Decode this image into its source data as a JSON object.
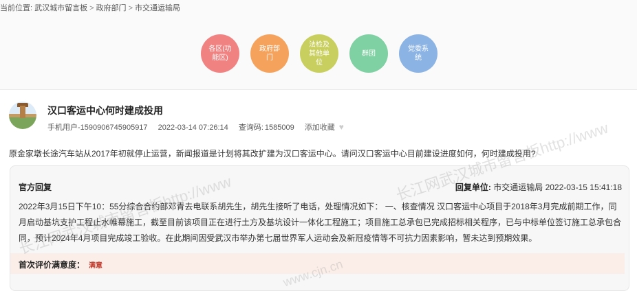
{
  "breadcrumb": {
    "label": "当前位置:",
    "items": [
      "武汉城市留言板",
      "政府部门",
      "市交通运输局"
    ],
    "separator": ">"
  },
  "categories": [
    {
      "label": "各区(功能区)",
      "color": "#f08282"
    },
    {
      "label": "政府部门",
      "color": "#f5a35c"
    },
    {
      "label": "法检及其他单位",
      "color": "#c8cf5e"
    },
    {
      "label": "群团",
      "color": "#7fd0a2"
    },
    {
      "label": "党委系统",
      "color": "#8bb3e3"
    }
  ],
  "post": {
    "title": "汉口客运中心何时建成投用",
    "user": "手机用户-1590906745905917",
    "datetime": "2022-03-14 07:26:14",
    "query_code_label": "查询码:",
    "query_code": "1585009",
    "favorite_label": "添加收藏",
    "question": "原金家墩长途汽车站从2017年初就停止运营，新闻报道是计划将其改扩建为汉口客运中心。请问汉口客运中心目前建设进度如何，何时建成投用?"
  },
  "reply": {
    "label": "官方回复",
    "unit_label": "回复单位:",
    "unit": "市交通运输局",
    "datetime": "2022-03-15 15:41:18",
    "body": "2022年3月15日下午10：55分综合合约部邓青去电联系胡先生，胡先生接听了电话，处理情况如下： 一、核查情况 汉口客运中心项目于2018年3月完成前期工作，同月启动基坑支护工程止水帷幕施工，截至目前该项目正在进行土方及基坑设计一体化工程施工；项目施工总承包已完成招标相关程序，已与中标单位签订施工总承包合同，预计2024年4月项目完成竣工验收。在此期间因受武汉市举办第七届世界军人运动会及新冠疫情等不可抗力因素影响，暂未达到预期效果。",
    "rating_label": "首次评价满意度：",
    "rating_value": "满意"
  },
  "watermark": {
    "line1": "长江网武汉城市留言板http://www",
    "line2": "长江网武汉城市留言板http://www",
    "line3": "www.cjn.cn"
  }
}
